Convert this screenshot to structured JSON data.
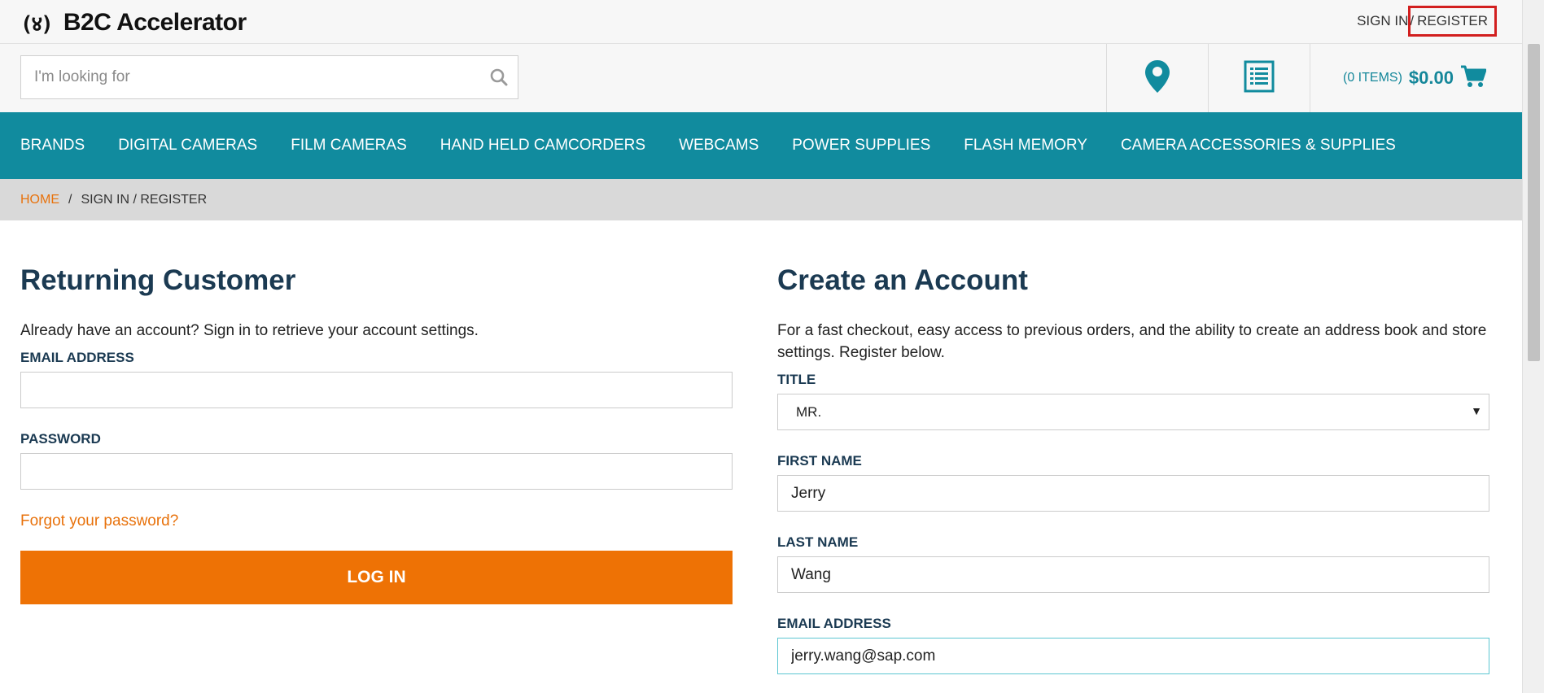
{
  "header": {
    "logo_mark": "(४)",
    "logo_text": "B2C Accelerator",
    "sign_in": "SIGN IN",
    "separator": "/",
    "register": "REGISTER"
  },
  "search": {
    "placeholder": "I'm looking for",
    "value": ""
  },
  "mini_cart": {
    "items": "(0 ITEMS)",
    "total": "$0.00"
  },
  "nav": {
    "items": [
      "BRANDS",
      "DIGITAL CAMERAS",
      "FILM CAMERAS",
      "HAND HELD CAMCORDERS",
      "WEBCAMS",
      "POWER SUPPLIES",
      "FLASH MEMORY",
      "CAMERA ACCESSORIES & SUPPLIES"
    ]
  },
  "breadcrumb": {
    "home": "HOME",
    "separator": "/",
    "current": "SIGN IN / REGISTER"
  },
  "login": {
    "title": "Returning Customer",
    "description": "Already have an account? Sign in to retrieve your account settings.",
    "email_label": "EMAIL ADDRESS",
    "email_value": "",
    "password_label": "PASSWORD",
    "password_value": "",
    "forgot": "Forgot your password?",
    "button": "LOG IN"
  },
  "register": {
    "title": "Create an Account",
    "description": "For a fast checkout, easy access to previous orders, and the ability to create an address book and store settings. Register below.",
    "title_label": "TITLE",
    "title_value": "MR.",
    "first_name_label": "FIRST NAME",
    "first_name_value": "Jerry",
    "last_name_label": "LAST NAME",
    "last_name_value": "Wang",
    "email_label": "EMAIL ADDRESS",
    "email_value": "jerry.wang@sap.com"
  },
  "colors": {
    "brand_teal": "#118b9e",
    "accent_orange": "#ee7205",
    "highlight_red": "#d21f1f"
  },
  "icons": {
    "search": "search-icon",
    "store": "map-pin-icon",
    "list": "list-icon",
    "cart": "cart-icon",
    "caret": "caret-down-icon"
  }
}
